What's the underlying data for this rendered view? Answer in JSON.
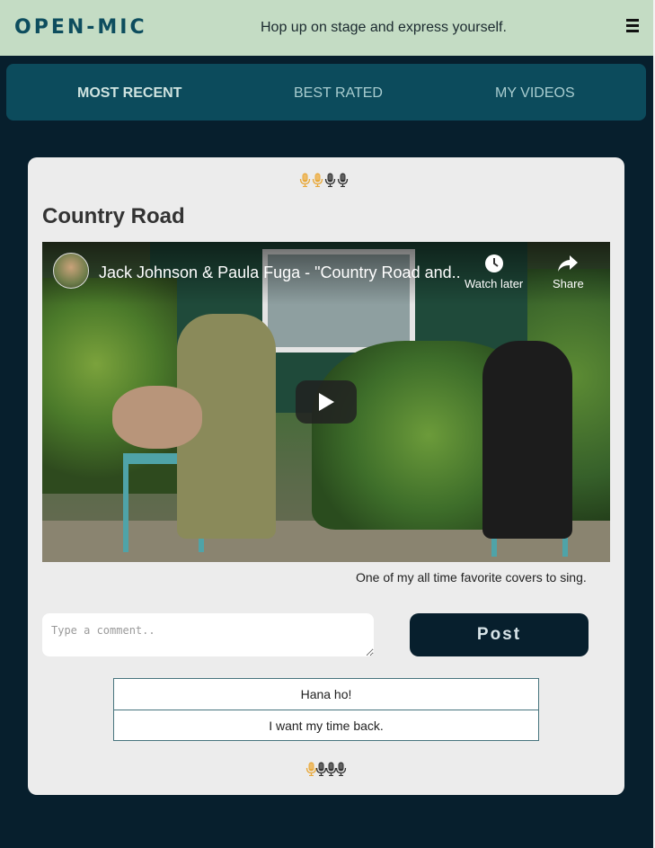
{
  "header": {
    "brand": "OPEN-MIC",
    "tagline": "Hop up on stage and express yourself.",
    "menu_icon": "hamburger-menu-icon"
  },
  "tabs": [
    {
      "label": "MOST RECENT",
      "active": true
    },
    {
      "label": "BEST RATED",
      "active": false
    },
    {
      "label": "MY VIDEOS",
      "active": false
    }
  ],
  "post": {
    "title": "Country Road",
    "rating_top": {
      "filled": 2,
      "total": 4
    },
    "video": {
      "title": "Jack Johnson & Paula Fuga - \"Country Road and..",
      "watch_later_label": "Watch later",
      "share_label": "Share"
    },
    "description": "One of my all time favorite covers to sing.",
    "comment_placeholder": "Type a comment..",
    "post_button_label": "Post",
    "comments": [
      "Hana ho!",
      "I want my time back."
    ],
    "rating_bottom": {
      "filled": 1,
      "total": 4
    }
  },
  "colors": {
    "background": "#071f2d",
    "header_bg": "#c4dcc4",
    "tabs_bg": "#0c4b5c",
    "card_bg": "#ececec",
    "mic_filled": "#e8a93c",
    "mic_empty": "#333333"
  }
}
